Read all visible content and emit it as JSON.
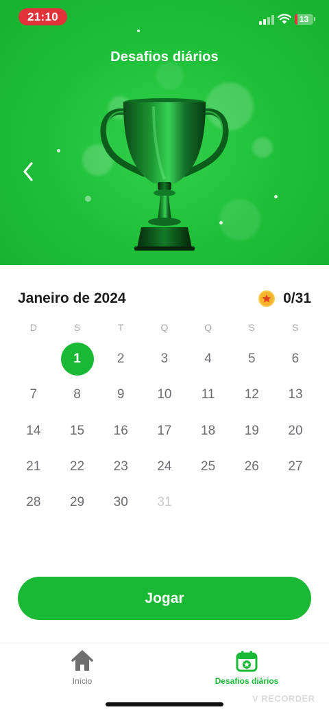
{
  "status_bar": {
    "time": "21:10",
    "battery": "13",
    "battery_fraction": 0.13,
    "icons": [
      "signal-icon",
      "wifi-icon",
      "battery-icon"
    ],
    "accent": "#e2333b"
  },
  "hero": {
    "title": "Desafios diários",
    "back_icon": "chevron-left-icon",
    "image": "trophy-icon",
    "background": "#1fc03a"
  },
  "calendar": {
    "month_title": "Janeiro de 2024",
    "progress_icon": "star-coin-icon",
    "progress": "0/31",
    "weekdays": [
      "D",
      "S",
      "T",
      "Q",
      "Q",
      "S",
      "S"
    ],
    "days": [
      "1",
      "2",
      "3",
      "4",
      "5",
      "6",
      "7",
      "8",
      "9",
      "10",
      "11",
      "12",
      "13",
      "14",
      "15",
      "16",
      "17",
      "18",
      "19",
      "20",
      "21",
      "22",
      "23",
      "24",
      "25",
      "26",
      "27",
      "28",
      "29",
      "30",
      "31"
    ],
    "first_weekday_index": 1,
    "selected_day": "1",
    "dimmed_days": [
      "31"
    ],
    "accent": "#19b935"
  },
  "play_button": {
    "label": "Jogar"
  },
  "tab_bar": {
    "items": [
      {
        "label": "Início",
        "icon": "home-icon",
        "active": false
      },
      {
        "label": "Desafios diários",
        "icon": "calendar-star-icon",
        "active": true
      }
    ]
  },
  "watermark": "V RECORDER"
}
